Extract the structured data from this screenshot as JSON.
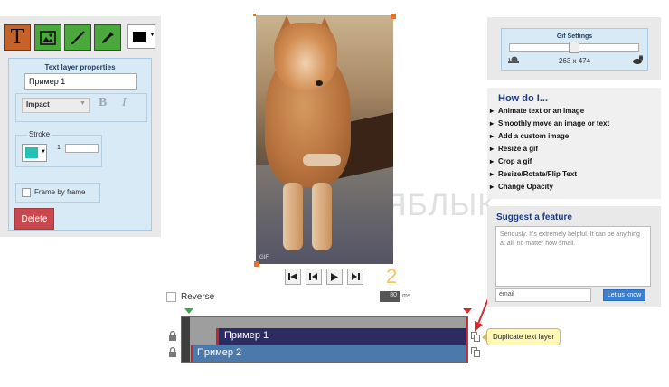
{
  "toolbar": {
    "text_tool": "T",
    "tools": [
      "text-tool",
      "image-tool",
      "brush-tool",
      "eyedropper-tool"
    ],
    "color": "#000000"
  },
  "text_layer_properties": {
    "title": "Text layer properties",
    "text_value": "Пример 1",
    "font": "Impact",
    "bold": "B",
    "italic": "I",
    "stroke_label": "Stroke",
    "stroke_color": "#23c1b3",
    "stroke_width": "1",
    "frame_by_frame_label": "Frame by frame",
    "delete_label": "Delete"
  },
  "canvas": {
    "watermark": "GIF",
    "background_watermark": "ЯБЛЫК"
  },
  "playback": {
    "current_frame": "2",
    "reverse_label": "Reverse",
    "delay_value": "80",
    "delay_unit": "ms"
  },
  "timeline": {
    "layers": [
      {
        "label": "Пример 1"
      },
      {
        "label": "Пример 2"
      }
    ],
    "tooltip": "Duplicate text layer"
  },
  "gif_settings": {
    "title": "Gif Settings",
    "size": "263 x 474"
  },
  "how_do_i": {
    "title": "How do I...",
    "items": [
      "Animate text or an image",
      "Smoothly move an image or text",
      "Add a custom image",
      "Resize a gif",
      "Crop a gif",
      "Resize/Rotate/Flip Text",
      "Change Opacity"
    ]
  },
  "suggest": {
    "title": "Suggest a feature",
    "placeholder": "Seriously. It's extremely helpful. It can be anything at all, no matter how small.",
    "email_placeholder": "email",
    "submit_label": "Let us know"
  }
}
